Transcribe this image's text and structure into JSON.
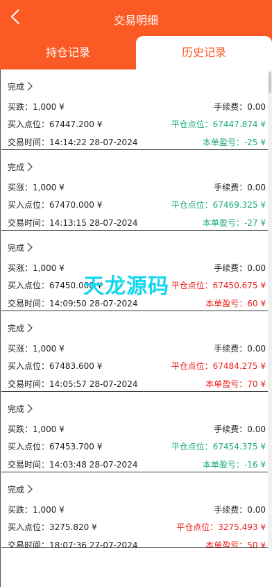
{
  "header": {
    "title": "交易明细",
    "bg_color": "#fb5a24"
  },
  "tabs": {
    "holding_label": "持仓记录",
    "history_label": "历史记录",
    "active": "history"
  },
  "labels": {
    "fee": "手续费：",
    "buy_point": "买入点位：",
    "close_point": "平仓点位：",
    "trade_time": "交易时间：",
    "pnl": "本单盈亏："
  },
  "colors": {
    "profit": "#ee1c1c",
    "loss": "#1aaa7a"
  },
  "watermark": "天龙源码",
  "records": [
    {
      "status": "完成",
      "direction": "买跌：1,000 ¥",
      "fee": "0.00",
      "buy_point": "67447.200 ¥",
      "close_point": "67447.874 ¥",
      "trade_time": "14:14:22 28-07-2024",
      "pnl": "-25 ¥",
      "result": "loss"
    },
    {
      "status": "完成",
      "direction": "买涨：1,000 ¥",
      "fee": "0.00",
      "buy_point": "67470.000 ¥",
      "close_point": "67469.325 ¥",
      "trade_time": "14:13:15 28-07-2024",
      "pnl": "-27 ¥",
      "result": "loss"
    },
    {
      "status": "完成",
      "direction": "买涨：1,000 ¥",
      "fee": "0.00",
      "buy_point": "67450.000 ¥",
      "close_point": "67450.675 ¥",
      "trade_time": "14:09:50 28-07-2024",
      "pnl": "60 ¥",
      "result": "profit"
    },
    {
      "status": "完成",
      "direction": "买涨：1,000 ¥",
      "fee": "0.00",
      "buy_point": "67483.600 ¥",
      "close_point": "67484.275 ¥",
      "trade_time": "14:05:57 28-07-2024",
      "pnl": "70 ¥",
      "result": "profit"
    },
    {
      "status": "完成",
      "direction": "买跌：1,000 ¥",
      "fee": "0.00",
      "buy_point": "67453.700 ¥",
      "close_point": "67454.375 ¥",
      "trade_time": "14:03:48 28-07-2024",
      "pnl": "-16 ¥",
      "result": "loss"
    },
    {
      "status": "完成",
      "direction": "买跌：1,000 ¥",
      "fee": "0.00",
      "buy_point": "3275.820 ¥",
      "close_point": "3275.493 ¥",
      "trade_time": "18:07:36 27-07-2024",
      "pnl": "50 ¥",
      "result": "profit"
    }
  ]
}
